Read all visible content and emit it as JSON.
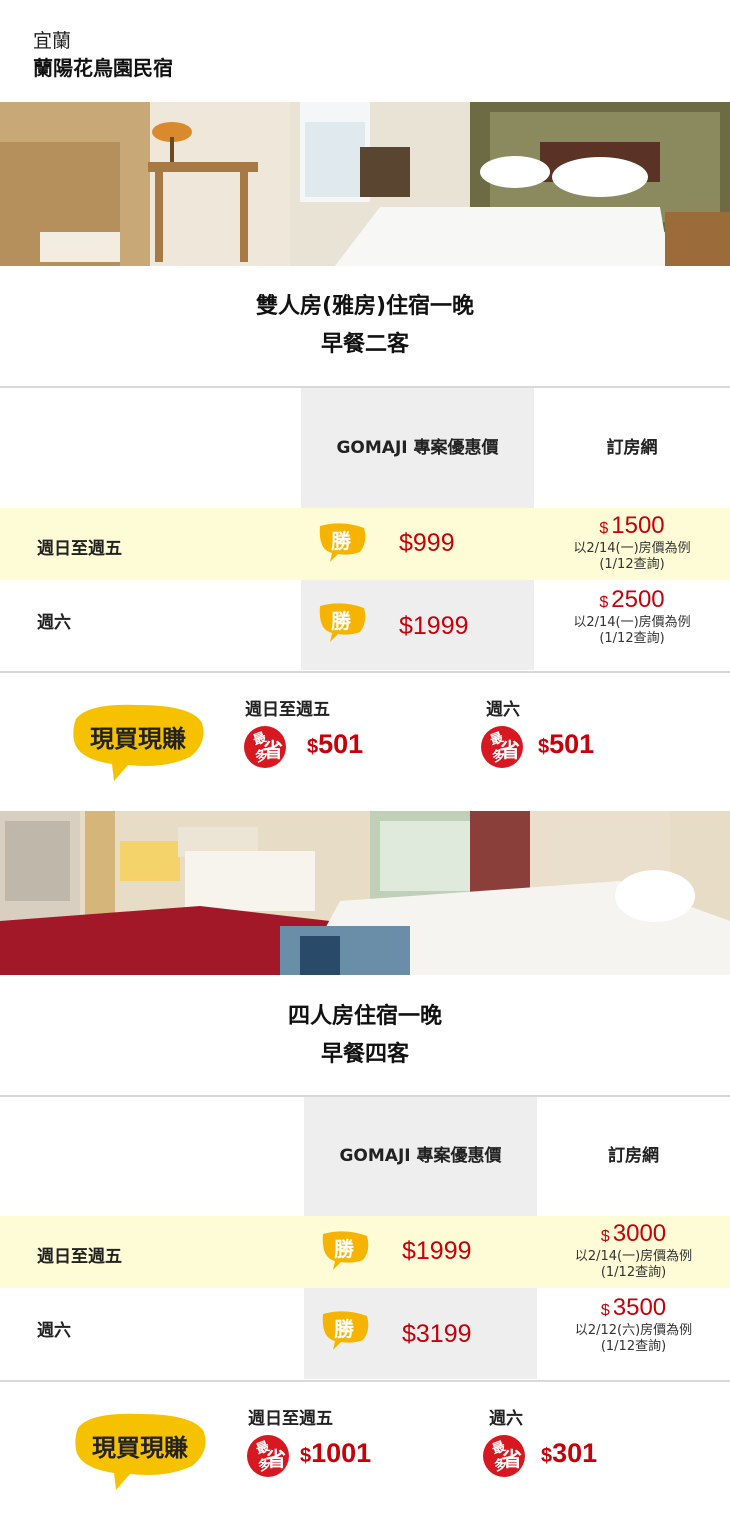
{
  "header": {
    "region": "宜蘭",
    "hotel_name": "蘭陽花鳥園民宿"
  },
  "rooms": [
    {
      "title_line1": "雙人房(雅房)住宿一晚",
      "title_line2": "早餐二客",
      "col_gomaji": "GOMAJI 專案優惠價",
      "col_ota": "訂房網",
      "rows": [
        {
          "label": "週日至週五",
          "badge": "勝",
          "gomaji_price": "$999",
          "ota_currency": "$",
          "ota_price": "1500",
          "ota_note1": "以2/14(一)房價為例",
          "ota_note2": "(1/12查詢)"
        },
        {
          "label": "週六",
          "badge": "勝",
          "gomaji_price": "$1999",
          "ota_currency": "$",
          "ota_price": "2500",
          "ota_note1": "以2/14(一)房價為例",
          "ota_note2": "(1/12查詢)"
        }
      ],
      "savings": {
        "logo_text": "現買現賺",
        "badge_small": "最多",
        "badge_big": "省",
        "weekday_label": "週日至週五",
        "weekday_currency": "$",
        "weekday_amount": "501",
        "saturday_label": "週六",
        "saturday_currency": "$",
        "saturday_amount": "501"
      }
    },
    {
      "title_line1": "四人房住宿一晚",
      "title_line2": "早餐四客",
      "col_gomaji": "GOMAJI 專案優惠價",
      "col_ota": "訂房網",
      "rows": [
        {
          "label": "週日至週五",
          "badge": "勝",
          "gomaji_price": "$1999",
          "ota_currency": "$",
          "ota_price": "3000",
          "ota_note1": "以2/14(一)房價為例",
          "ota_note2": "(1/12查詢)"
        },
        {
          "label": "週六",
          "badge": "勝",
          "gomaji_price": "$3199",
          "ota_currency": "$",
          "ota_price": "3500",
          "ota_note1": "以2/12(六)房價為例",
          "ota_note2": "(1/12查詢)"
        }
      ],
      "savings": {
        "logo_text": "現買現賺",
        "badge_small": "最多",
        "badge_big": "省",
        "weekday_label": "週日至週五",
        "weekday_currency": "$",
        "weekday_amount": "1001",
        "saturday_label": "週六",
        "saturday_currency": "$",
        "saturday_amount": "301"
      }
    }
  ],
  "colors": {
    "price_red": "#c8000a",
    "highlight_yellow": "#fefcd6",
    "badge_yellow": "#f6b400",
    "gomaji_gray": "#eeeeee"
  }
}
